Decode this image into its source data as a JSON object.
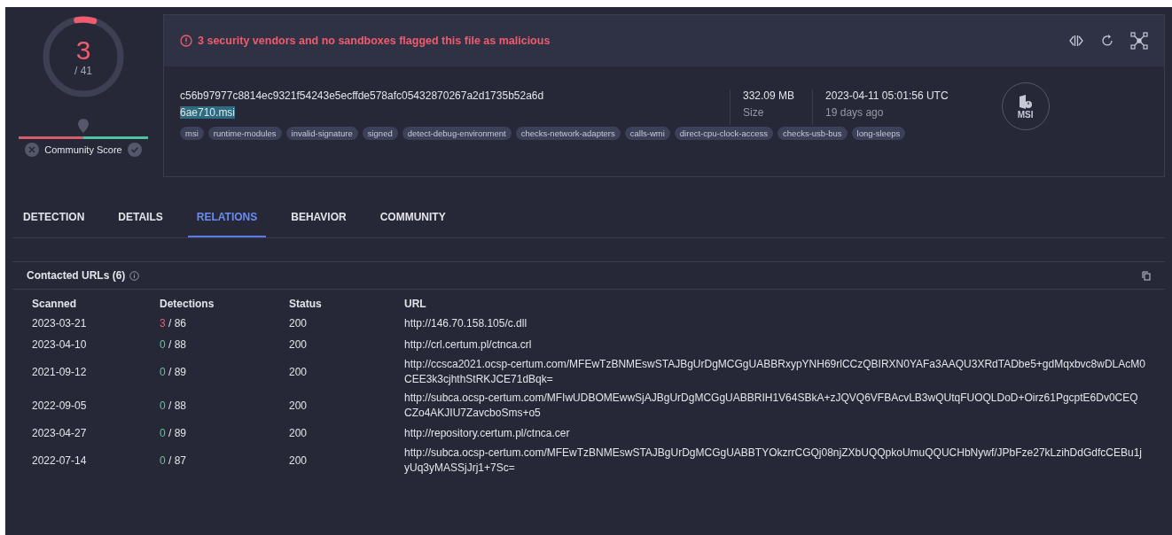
{
  "score": {
    "count": "3",
    "total": "/ 41",
    "level": 0.073,
    "community_label": "Community Score"
  },
  "alert": {
    "message": "3 security vendors and no sandboxes flagged this file as malicious"
  },
  "file": {
    "hash": "c56b97977c8814ec9321f54243e5ecffde578afc05432870267a2d1735b52a6d",
    "name": "6ae710.msi",
    "size": "332.09 MB",
    "size_label": "Size",
    "date": "2023-04-11 05:01:56 UTC",
    "date_ago": "19 days ago",
    "type_label": "MSI"
  },
  "tags": [
    "msi",
    "runtime-modules",
    "invalid-signature",
    "signed",
    "detect-debug-environment",
    "checks-network-adapters",
    "calls-wmi",
    "direct-cpu-clock-access",
    "checks-usb-bus",
    "long-sleeps"
  ],
  "tabs": [
    {
      "label": "DETECTION",
      "selected": false
    },
    {
      "label": "DETAILS",
      "selected": false
    },
    {
      "label": "RELATIONS",
      "selected": true
    },
    {
      "label": "BEHAVIOR",
      "selected": false
    },
    {
      "label": "COMMUNITY",
      "selected": false
    }
  ],
  "section": {
    "title": "Contacted URLs (6)"
  },
  "table": {
    "columns": [
      "Scanned",
      "Detections",
      "Status",
      "URL"
    ],
    "rows": [
      {
        "scanned": "2023-03-21",
        "detected": "3",
        "total": "/ 86",
        "malicious": true,
        "status": "200",
        "url": "http://146.70.158.105/c.dll"
      },
      {
        "scanned": "2023-04-10",
        "detected": "0",
        "total": "/ 88",
        "malicious": false,
        "status": "200",
        "url": "http://crl.certum.pl/ctnca.crl"
      },
      {
        "scanned": "2021-09-12",
        "detected": "0",
        "total": "/ 89",
        "malicious": false,
        "status": "200",
        "url": "http://ccsca2021.ocsp-certum.com/MFEwTzBNMEswSTAJBgUrDgMCGgUABBRxypYNH69rlCCzQBIRXN0YAFa3AAQU3XRdTADbe5+gdMqxbvc8wDLAcM0CEE3k3cjhthStRKJCE71dBqk="
      },
      {
        "scanned": "2022-09-05",
        "detected": "0",
        "total": "/ 88",
        "malicious": false,
        "status": "200",
        "url": "http://subca.ocsp-certum.com/MFIwUDBOMEwwSjAJBgUrDgMCGgUABBRIH1V64SBkA+zJQVQ6VFBAcvLB3wQUtqFUOQLDoD+Oirz61PgcptE6Dv0CEQCZo4AKJIU7ZavcboSms+o5"
      },
      {
        "scanned": "2023-04-27",
        "detected": "0",
        "total": "/ 89",
        "malicious": false,
        "status": "200",
        "url": "http://repository.certum.pl/ctnca.cer"
      },
      {
        "scanned": "2022-07-14",
        "detected": "0",
        "total": "/ 87",
        "malicious": false,
        "status": "200",
        "url": "http://subca.ocsp-certum.com/MFEwTzBNMEswSTAJBgUrDgMCGgUABBTYOkzrrCGQj08njZXbUQQpkoUmuQQUCHbNywf/JPbFze27kLzihDdGdfcCEBu1jyUq3yMASSjJrj1+7Sc="
      }
    ]
  }
}
